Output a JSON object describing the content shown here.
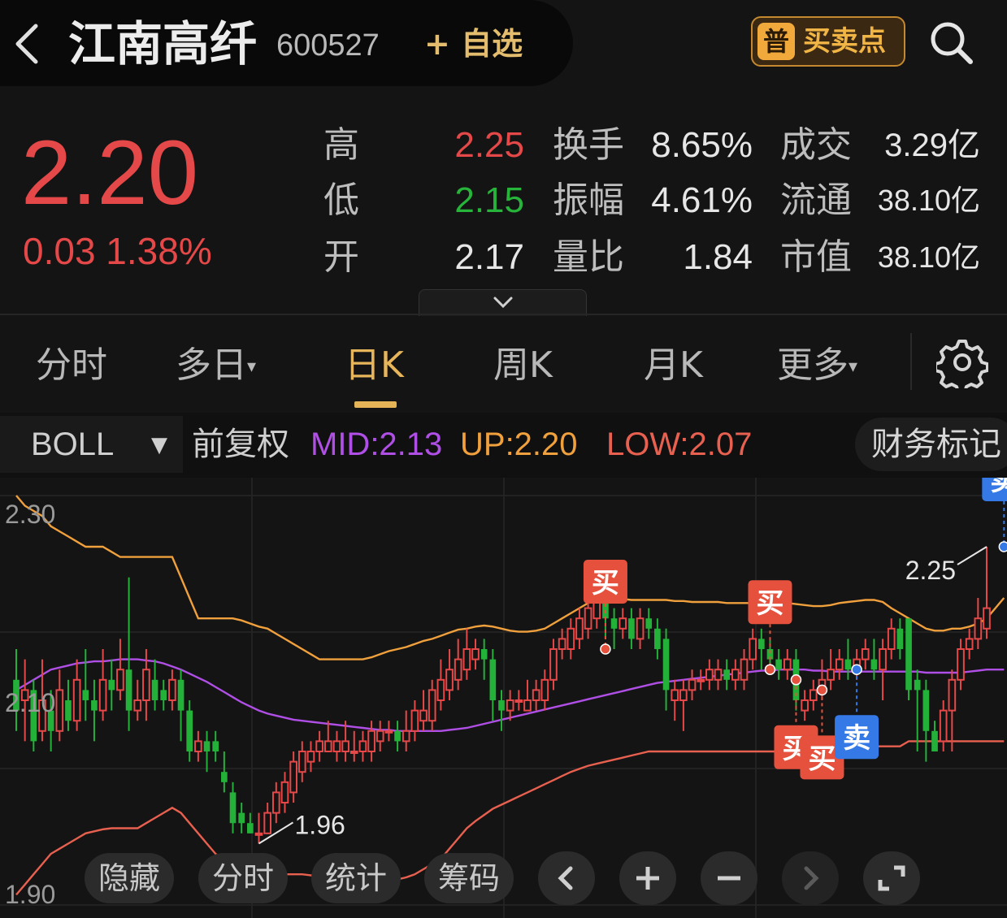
{
  "header": {
    "stock_name": "江南高纤",
    "stock_code": "600527",
    "watch_label": "+ 自选",
    "bsp_icon_char": "普",
    "bsp_label": "买卖点"
  },
  "quote": {
    "price": "2.20",
    "change": "0.03 1.38%",
    "rows": [
      {
        "l1": "高",
        "v1": "2.25",
        "c1": "#e54848",
        "l2": "换手",
        "v2": "8.65%",
        "l3": "成交",
        "v3": "3.29亿"
      },
      {
        "l1": "低",
        "v1": "2.15",
        "c1": "#27b43a",
        "l2": "振幅",
        "v2": "4.61%",
        "l3": "流通",
        "v3": "38.10亿"
      },
      {
        "l1": "开",
        "v1": "2.17",
        "c1": "#e6e6e6",
        "l2": "量比",
        "v2": "1.84",
        "l3": "市值",
        "v3": "38.10亿"
      }
    ]
  },
  "tabs": {
    "fenshi": "分时",
    "duori": "多日",
    "rik": "日K",
    "zhouk": "周K",
    "yuek": "月K",
    "gengduo": "更多",
    "active": "日K"
  },
  "indicator": {
    "name": "BOLL",
    "adjust": "前复权",
    "mid": "MID:2.13",
    "up": "UP:2.20",
    "low": "LOW:2.07",
    "mid_color": "#b04fe6",
    "up_color": "#f0a03c",
    "low_color": "#e8604f",
    "fin_label": "财务标记"
  },
  "chart_data": {
    "type": "candlestick",
    "y_ticks": [
      "2.30",
      "2.10",
      "1.90"
    ],
    "ylim": [
      1.9,
      2.3
    ],
    "high_label": "2.25",
    "low_label": "1.96",
    "up_color": "#e54848",
    "down_color": "#24b13a",
    "candles": [
      [
        2.12,
        2.09,
        2.15,
        2.07
      ],
      [
        2.1,
        2.11,
        2.14,
        2.06
      ],
      [
        2.11,
        2.06,
        2.12,
        2.05
      ],
      [
        2.07,
        2.1,
        2.14,
        2.06
      ],
      [
        2.09,
        2.07,
        2.11,
        2.05
      ],
      [
        2.07,
        2.11,
        2.13,
        2.06
      ],
      [
        2.1,
        2.08,
        2.12,
        2.07
      ],
      [
        2.08,
        2.12,
        2.14,
        2.07
      ],
      [
        2.11,
        2.1,
        2.15,
        2.08
      ],
      [
        2.1,
        2.09,
        2.12,
        2.06
      ],
      [
        2.09,
        2.12,
        2.15,
        2.08
      ],
      [
        2.12,
        2.11,
        2.14,
        2.09
      ],
      [
        2.11,
        2.13,
        2.16,
        2.1
      ],
      [
        2.13,
        2.09,
        2.22,
        2.07
      ],
      [
        2.09,
        2.1,
        2.12,
        2.08
      ],
      [
        2.1,
        2.13,
        2.15,
        2.08
      ],
      [
        2.12,
        2.1,
        2.14,
        2.09
      ],
      [
        2.11,
        2.1,
        2.12,
        2.09
      ],
      [
        2.1,
        2.12,
        2.13,
        2.09
      ],
      [
        2.12,
        2.09,
        2.13,
        2.06
      ],
      [
        2.09,
        2.05,
        2.1,
        2.04
      ],
      [
        2.05,
        2.06,
        2.07,
        2.04
      ],
      [
        2.06,
        2.05,
        2.07,
        2.03
      ],
      [
        2.06,
        2.05,
        2.07,
        2.04
      ],
      [
        2.03,
        2.02,
        2.05,
        2.01
      ],
      [
        2.01,
        1.98,
        2.02,
        1.97
      ],
      [
        1.99,
        1.98,
        2.0,
        1.97
      ],
      [
        1.98,
        1.97,
        1.99,
        1.97
      ],
      [
        1.97,
        1.97,
        1.99,
        1.96
      ],
      [
        1.97,
        1.99,
        2.0,
        1.97
      ],
      [
        1.99,
        2.01,
        2.02,
        1.98
      ],
      [
        2.0,
        2.02,
        2.03,
        1.99
      ],
      [
        2.01,
        2.04,
        2.05,
        2.0
      ],
      [
        2.03,
        2.05,
        2.06,
        2.02
      ],
      [
        2.04,
        2.05,
        2.06,
        2.03
      ],
      [
        2.05,
        2.06,
        2.07,
        2.04
      ],
      [
        2.05,
        2.06,
        2.08,
        2.05
      ],
      [
        2.05,
        2.06,
        2.07,
        2.04
      ],
      [
        2.05,
        2.06,
        2.08,
        2.04
      ],
      [
        2.05,
        2.05,
        2.07,
        2.04
      ],
      [
        2.05,
        2.06,
        2.07,
        2.04
      ],
      [
        2.05,
        2.07,
        2.08,
        2.04
      ],
      [
        2.06,
        2.07,
        2.08,
        2.05
      ],
      [
        2.07,
        2.07,
        2.08,
        2.06
      ],
      [
        2.07,
        2.06,
        2.08,
        2.05
      ],
      [
        2.06,
        2.07,
        2.09,
        2.05
      ],
      [
        2.07,
        2.09,
        2.1,
        2.06
      ],
      [
        2.08,
        2.09,
        2.11,
        2.07
      ],
      [
        2.08,
        2.11,
        2.12,
        2.07
      ],
      [
        2.1,
        2.12,
        2.14,
        2.09
      ],
      [
        2.11,
        2.13,
        2.15,
        2.1
      ],
      [
        2.12,
        2.14,
        2.16,
        2.11
      ],
      [
        2.13,
        2.15,
        2.17,
        2.12
      ],
      [
        2.14,
        2.15,
        2.16,
        2.13
      ],
      [
        2.15,
        2.14,
        2.16,
        2.12
      ],
      [
        2.14,
        2.1,
        2.15,
        2.08
      ],
      [
        2.1,
        2.09,
        2.11,
        2.07
      ],
      [
        2.09,
        2.1,
        2.11,
        2.08
      ],
      [
        2.1,
        2.1,
        2.11,
        2.09
      ],
      [
        2.09,
        2.1,
        2.12,
        2.09
      ],
      [
        2.1,
        2.11,
        2.12,
        2.09
      ],
      [
        2.1,
        2.12,
        2.13,
        2.09
      ],
      [
        2.12,
        2.15,
        2.16,
        2.11
      ],
      [
        2.15,
        2.16,
        2.17,
        2.14
      ],
      [
        2.15,
        2.17,
        2.18,
        2.14
      ],
      [
        2.16,
        2.18,
        2.19,
        2.15
      ],
      [
        2.17,
        2.19,
        2.2,
        2.16
      ],
      [
        2.18,
        2.2,
        2.21,
        2.17
      ],
      [
        2.2,
        2.18,
        2.21,
        2.16
      ],
      [
        2.18,
        2.17,
        2.19,
        2.15
      ],
      [
        2.17,
        2.18,
        2.19,
        2.16
      ],
      [
        2.18,
        2.16,
        2.19,
        2.15
      ],
      [
        2.16,
        2.18,
        2.19,
        2.15
      ],
      [
        2.18,
        2.17,
        2.19,
        2.16
      ],
      [
        2.17,
        2.15,
        2.18,
        2.14
      ],
      [
        2.16,
        2.11,
        2.17,
        2.09
      ],
      [
        2.1,
        2.11,
        2.12,
        2.08
      ],
      [
        2.1,
        2.11,
        2.12,
        2.07
      ],
      [
        2.11,
        2.12,
        2.13,
        2.1
      ],
      [
        2.12,
        2.12,
        2.13,
        2.11
      ],
      [
        2.12,
        2.13,
        2.14,
        2.11
      ],
      [
        2.12,
        2.13,
        2.14,
        2.11
      ],
      [
        2.13,
        2.12,
        2.14,
        2.11
      ],
      [
        2.12,
        2.13,
        2.14,
        2.11
      ],
      [
        2.12,
        2.14,
        2.15,
        2.11
      ],
      [
        2.14,
        2.16,
        2.17,
        2.13
      ],
      [
        2.16,
        2.15,
        2.17,
        2.13
      ],
      [
        2.15,
        2.14,
        2.16,
        2.13
      ],
      [
        2.14,
        2.13,
        2.15,
        2.12
      ],
      [
        2.13,
        2.14,
        2.15,
        2.12
      ],
      [
        2.14,
        2.1,
        2.15,
        2.09
      ],
      [
        2.09,
        2.1,
        2.11,
        2.08
      ],
      [
        2.1,
        2.11,
        2.12,
        2.09
      ],
      [
        2.11,
        2.12,
        2.14,
        2.1
      ],
      [
        2.12,
        2.13,
        2.15,
        2.11
      ],
      [
        2.13,
        2.14,
        2.15,
        2.12
      ],
      [
        2.14,
        2.13,
        2.16,
        2.12
      ],
      [
        2.13,
        2.14,
        2.15,
        2.12
      ],
      [
        2.14,
        2.15,
        2.16,
        2.13
      ],
      [
        2.14,
        2.13,
        2.16,
        2.12
      ],
      [
        2.13,
        2.15,
        2.16,
        2.1
      ],
      [
        2.15,
        2.17,
        2.18,
        2.14
      ],
      [
        2.17,
        2.15,
        2.18,
        2.14
      ],
      [
        2.18,
        2.11,
        2.18,
        2.1
      ],
      [
        2.12,
        2.11,
        2.13,
        2.05
      ],
      [
        2.11,
        2.07,
        2.12,
        2.04
      ],
      [
        2.07,
        2.05,
        2.08,
        2.05
      ],
      [
        2.06,
        2.09,
        2.1,
        2.05
      ],
      [
        2.09,
        2.12,
        2.13,
        2.05
      ],
      [
        2.12,
        2.15,
        2.16,
        2.11
      ],
      [
        2.15,
        2.16,
        2.17,
        2.14
      ],
      [
        2.16,
        2.18,
        2.2,
        2.15
      ],
      [
        2.17,
        2.19,
        2.25,
        2.16
      ]
    ],
    "boll": {
      "up": [
        2.3,
        2.29,
        2.285,
        2.28,
        2.27,
        2.265,
        2.26,
        2.255,
        2.25,
        2.25,
        2.25,
        2.245,
        2.24,
        2.24,
        2.24,
        2.24,
        2.24,
        2.24,
        2.24,
        2.22,
        2.2,
        2.18,
        2.18,
        2.18,
        2.18,
        2.18,
        2.178,
        2.175,
        2.172,
        2.17,
        2.165,
        2.16,
        2.155,
        2.15,
        2.145,
        2.14,
        2.14,
        2.14,
        2.14,
        2.14,
        2.14,
        2.142,
        2.145,
        2.148,
        2.15,
        2.152,
        2.155,
        2.158,
        2.16,
        2.163,
        2.166,
        2.169,
        2.17,
        2.172,
        2.173,
        2.172,
        2.17,
        2.168,
        2.167,
        2.167,
        2.168,
        2.17,
        2.175,
        2.18,
        2.185,
        2.19,
        2.195,
        2.2,
        2.2,
        2.2,
        2.199,
        2.198,
        2.198,
        2.198,
        2.198,
        2.198,
        2.197,
        2.197,
        2.196,
        2.196,
        2.196,
        2.196,
        2.195,
        2.195,
        2.195,
        2.195,
        2.195,
        2.195,
        2.195,
        2.195,
        2.194,
        2.193,
        2.192,
        2.192,
        2.193,
        2.195,
        2.196,
        2.197,
        2.198,
        2.198,
        2.196,
        2.19,
        2.185,
        2.18,
        2.175,
        2.17,
        2.168,
        2.168,
        2.17,
        2.17,
        2.172,
        2.175,
        2.18,
        2.19,
        2.2
      ],
      "mid": [
        2.11,
        2.115,
        2.12,
        2.125,
        2.13,
        2.132,
        2.134,
        2.136,
        2.137,
        2.138,
        2.138,
        2.139,
        2.14,
        2.14,
        2.14,
        2.139,
        2.138,
        2.136,
        2.133,
        2.13,
        2.126,
        2.122,
        2.118,
        2.113,
        2.108,
        2.103,
        2.098,
        2.094,
        2.09,
        2.087,
        2.085,
        2.083,
        2.081,
        2.08,
        2.079,
        2.078,
        2.077,
        2.076,
        2.075,
        2.074,
        2.073,
        2.072,
        2.071,
        2.071,
        2.07,
        2.07,
        2.07,
        2.07,
        2.07,
        2.07,
        2.071,
        2.072,
        2.073,
        2.075,
        2.077,
        2.079,
        2.081,
        2.083,
        2.085,
        2.087,
        2.089,
        2.091,
        2.093,
        2.095,
        2.097,
        2.099,
        2.101,
        2.103,
        2.105,
        2.107,
        2.109,
        2.111,
        2.113,
        2.115,
        2.117,
        2.118,
        2.119,
        2.12,
        2.121,
        2.122,
        2.123,
        2.124,
        2.125,
        2.126,
        2.127,
        2.128,
        2.129,
        2.129,
        2.13,
        2.13,
        2.13,
        2.13,
        2.129,
        2.129,
        2.128,
        2.128,
        2.128,
        2.128,
        2.128,
        2.128,
        2.128,
        2.128,
        2.128,
        2.128,
        2.128,
        2.127,
        2.127,
        2.127,
        2.127,
        2.127,
        2.128,
        2.129,
        2.13,
        2.13,
        2.13
      ],
      "low": [
        1.91,
        1.92,
        1.93,
        1.94,
        1.95,
        1.955,
        1.96,
        1.965,
        1.97,
        1.972,
        1.974,
        1.975,
        1.975,
        1.975,
        1.975,
        1.98,
        1.985,
        1.99,
        1.995,
        1.99,
        1.98,
        1.97,
        1.96,
        1.95,
        1.945,
        1.94,
        1.935,
        1.93,
        1.93,
        1.93,
        1.93,
        1.93,
        1.93,
        1.93,
        1.929,
        1.928,
        1.927,
        1.926,
        1.925,
        1.925,
        1.925,
        1.924,
        1.924,
        1.924,
        1.925,
        1.927,
        1.93,
        1.935,
        1.94,
        1.945,
        1.955,
        1.965,
        1.975,
        1.982,
        1.988,
        1.994,
        1.998,
        2.002,
        2.006,
        2.01,
        2.014,
        2.018,
        2.022,
        2.026,
        2.03,
        2.033,
        2.036,
        2.038,
        2.04,
        2.042,
        2.044,
        2.046,
        2.048,
        2.05,
        2.05,
        2.05,
        2.05,
        2.05,
        2.05,
        2.05,
        2.05,
        2.05,
        2.05,
        2.05,
        2.05,
        2.05,
        2.05,
        2.05,
        2.05,
        2.05,
        2.05,
        2.05,
        2.05,
        2.05,
        2.05,
        2.05,
        2.05,
        2.05,
        2.055,
        2.055,
        2.055,
        2.055,
        2.055,
        2.06,
        2.06,
        2.06,
        2.06,
        2.06,
        2.06,
        2.06,
        2.06,
        2.06,
        2.06,
        2.06,
        2.06
      ]
    },
    "signals": [
      {
        "idx": 68,
        "kind": "buy",
        "label": "买",
        "price": 2.15,
        "pos": "above"
      },
      {
        "idx": 87,
        "kind": "buy",
        "label": "买",
        "price": 2.13,
        "pos": "above"
      },
      {
        "idx": 90,
        "kind": "buy",
        "label": "买",
        "price": 2.12,
        "pos": "below"
      },
      {
        "idx": 93,
        "kind": "buy",
        "label": "买",
        "price": 2.11,
        "pos": "below"
      },
      {
        "idx": 97,
        "kind": "sell",
        "label": "卖",
        "price": 2.13,
        "pos": "below"
      },
      {
        "idx": 114,
        "kind": "sell",
        "label": "卖",
        "price": 2.25,
        "pos": "above"
      }
    ],
    "sell_color": "#3479e6",
    "buy_color": "#e5513d"
  },
  "bottom_bar": {
    "hide": "隐藏",
    "fenshi": "分时",
    "stats": "统计",
    "chips": "筹码"
  },
  "icons": {
    "back": "chevron-left-icon",
    "search": "search-icon",
    "settings": "gear-icon",
    "expand": "chevron-down-icon",
    "prev": "chevron-left-icon",
    "zoom_in": "plus-icon",
    "zoom_out": "minus-icon",
    "next": "chevron-right-icon",
    "fullscreen": "fullscreen-icon"
  }
}
